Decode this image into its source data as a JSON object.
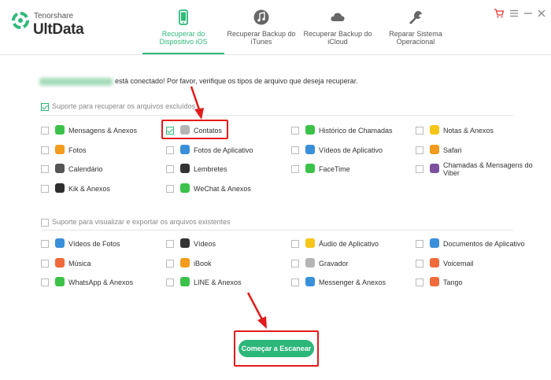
{
  "app": {
    "brand_small": "Tenorshare",
    "brand_name": "UltData",
    "accent": "#2fb97a"
  },
  "tabs": [
    {
      "label": "Recuperar do\nDispositivo iOS",
      "icon": "phone-icon",
      "active": true
    },
    {
      "label": "Recuperar Backup do\niTunes",
      "icon": "music-note-icon",
      "active": false
    },
    {
      "label": "Recuperar Backup do\niCloud",
      "icon": "cloud-icon",
      "active": false
    },
    {
      "label": "Reparar Sistema\nOperacional",
      "icon": "wrench-icon",
      "active": false
    }
  ],
  "window_controls": [
    "cart-icon",
    "menu-icon",
    "minimize-icon",
    "close-icon"
  ],
  "intro_text": "está conectado! Por favor, verifique os tipos de arquivo que deseja recuperar.",
  "sections": {
    "deleted": "Suporte para recuperar os arquivos excluídos",
    "existing": "Suporte para visualizar e exportar os arquivos existentes"
  },
  "deleted_items": [
    {
      "label": "Mensagens & Anexos",
      "icon": "messages-icon",
      "color": "#3cc24a",
      "checked": false
    },
    {
      "label": "Contatos",
      "icon": "contacts-icon",
      "color": "#b5b5b5",
      "checked": true
    },
    {
      "label": "Histórico de Chamadas",
      "icon": "phone-call-icon",
      "color": "#3cc24a",
      "checked": false
    },
    {
      "label": "Notas & Anexos",
      "icon": "notes-icon",
      "color": "#f5c518",
      "checked": false
    },
    {
      "label": "Fotos",
      "icon": "photos-icon",
      "color": "#f29b1d",
      "checked": false
    },
    {
      "label": "Fotos de Aplicativo",
      "icon": "app-photos-icon",
      "color": "#3a8fd9",
      "checked": false
    },
    {
      "label": "Vídeos de Aplicativo",
      "icon": "app-videos-icon",
      "color": "#3a8fd9",
      "checked": false
    },
    {
      "label": "Safari",
      "icon": "safari-icon",
      "color": "#f29b1d",
      "checked": false
    },
    {
      "label": "Calendário",
      "icon": "calendar-icon",
      "color": "#555555",
      "checked": false
    },
    {
      "label": "Lembretes",
      "icon": "reminders-icon",
      "color": "#333333",
      "checked": false
    },
    {
      "label": "FaceTime",
      "icon": "facetime-icon",
      "color": "#3cc24a",
      "checked": false
    },
    {
      "label": "Chamadas & Mensagens do Viber",
      "icon": "viber-icon",
      "color": "#7b519d",
      "checked": false
    },
    {
      "label": "Kik & Anexos",
      "icon": "kik-icon",
      "color": "#2d2d2d",
      "checked": false
    },
    {
      "label": "WeChat & Anexos",
      "icon": "wechat-icon",
      "color": "#3cc24a",
      "checked": false
    }
  ],
  "existing_items": [
    {
      "label": "Vídeos de Fotos",
      "icon": "photo-videos-icon",
      "color": "#3a8fd9",
      "checked": false
    },
    {
      "label": "Vídeos",
      "icon": "videos-icon",
      "color": "#333333",
      "checked": false
    },
    {
      "label": "Áudio de Aplicativo",
      "icon": "app-audio-icon",
      "color": "#f5c518",
      "checked": false
    },
    {
      "label": "Documentos de Aplicativo",
      "icon": "app-documents-icon",
      "color": "#3a8fd9",
      "checked": false
    },
    {
      "label": "Música",
      "icon": "music-icon",
      "color": "#f06a3c",
      "checked": false
    },
    {
      "label": "iBook",
      "icon": "ibook-icon",
      "color": "#f29b1d",
      "checked": false
    },
    {
      "label": "Gravador",
      "icon": "recorder-icon",
      "color": "#b5b5b5",
      "checked": false
    },
    {
      "label": "Voicemail",
      "icon": "voicemail-icon",
      "color": "#f06a3c",
      "checked": false
    },
    {
      "label": "WhatsApp & Anexos",
      "icon": "whatsapp-icon",
      "color": "#3cc24a",
      "checked": false
    },
    {
      "label": "LINE & Anexos",
      "icon": "line-icon",
      "color": "#3cc24a",
      "checked": false
    },
    {
      "label": "Messenger & Anexos",
      "icon": "messenger-icon",
      "color": "#3a8fd9",
      "checked": false
    },
    {
      "label": "Tango",
      "icon": "tango-icon",
      "color": "#f06a3c",
      "checked": false
    }
  ],
  "scan_button": "Começar a Escanear"
}
